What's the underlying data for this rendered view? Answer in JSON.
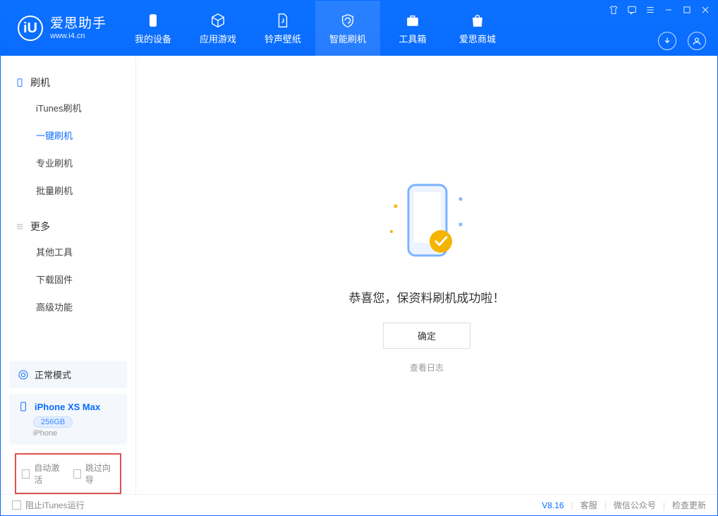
{
  "colors": {
    "accent": "#0a6cff",
    "highlight_border": "#d9534f"
  },
  "header": {
    "app_name": "爱思助手",
    "app_url": "www.i4.cn",
    "tabs": [
      {
        "label": "我的设备"
      },
      {
        "label": "应用游戏"
      },
      {
        "label": "铃声壁纸"
      },
      {
        "label": "智能刷机"
      },
      {
        "label": "工具箱"
      },
      {
        "label": "爱思商城"
      }
    ]
  },
  "sidebar": {
    "group1": {
      "title": "刷机",
      "items": [
        {
          "label": "iTunes刷机"
        },
        {
          "label": "一键刷机"
        },
        {
          "label": "专业刷机"
        },
        {
          "label": "批量刷机"
        }
      ]
    },
    "group2": {
      "title": "更多",
      "items": [
        {
          "label": "其他工具"
        },
        {
          "label": "下载固件"
        },
        {
          "label": "高级功能"
        }
      ]
    },
    "mode_label": "正常模式",
    "device_name": "iPhone XS Max",
    "storage": "256GB",
    "device_type": "iPhone",
    "opt_auto_activate": "自动激活",
    "opt_skip_guide": "跳过向导"
  },
  "main": {
    "success_text": "恭喜您，保资料刷机成功啦！",
    "ok_button": "确定",
    "view_log": "查看日志"
  },
  "statusbar": {
    "block_itunes": "阻止iTunes运行",
    "version": "V8.16",
    "support": "客服",
    "wechat": "微信公众号",
    "check_update": "检查更新"
  }
}
